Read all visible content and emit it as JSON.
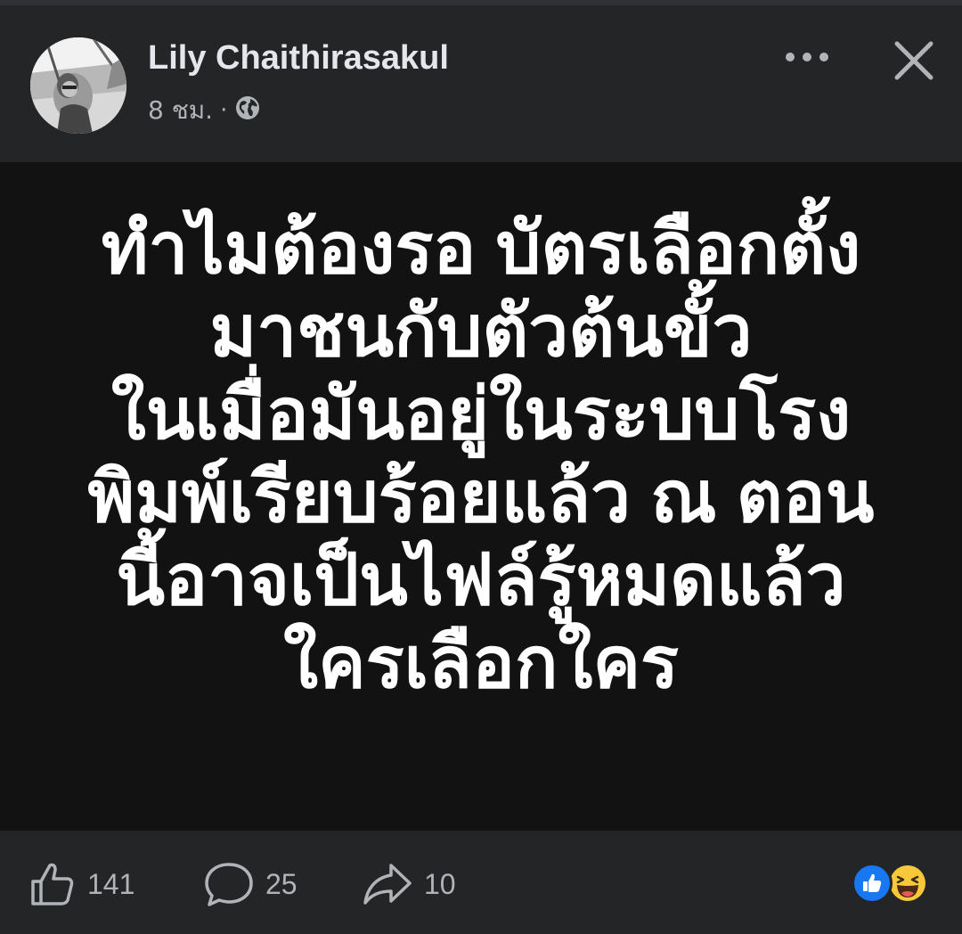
{
  "post": {
    "author": "Lily Chaithirasakul",
    "time": "8 ชม.",
    "separator": "·",
    "privacy_icon": "globe-icon",
    "text_lines": [
      "ทำไมต้องรอ บัตรเลือกตั้ง",
      "มาชนกับตัวต้นขั้ว",
      "ในเมื่อมันอยู่ในระบบโรง",
      "พิมพ์เรียบร้อยแล้ว ณ ตอน",
      "นี้อาจเป็นไฟล์รู้หมดแล้ว",
      "ใครเลือกใคร"
    ],
    "background_color": "#121212",
    "text_color": "#ffffff"
  },
  "header_actions": {
    "more_icon": "more-horizontal-icon",
    "close_icon": "close-icon"
  },
  "footer": {
    "like": {
      "icon": "thumbs-up-icon",
      "count": "141"
    },
    "comment": {
      "icon": "comment-icon",
      "count": "25"
    },
    "share": {
      "icon": "share-arrow-icon",
      "count": "10"
    },
    "reactions": [
      "like-reaction-icon",
      "haha-reaction-icon"
    ],
    "like_reaction_color": "#1877f2"
  }
}
